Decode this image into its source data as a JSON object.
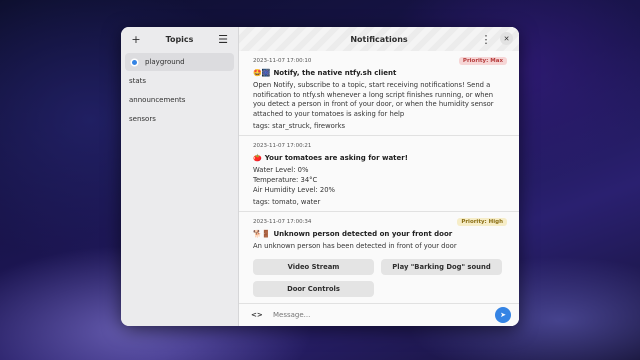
{
  "sidebar": {
    "title": "Topics",
    "add_icon": "+",
    "menu_icon": "☰",
    "topics": [
      {
        "label": "playground",
        "selected": true
      },
      {
        "label": "stats"
      },
      {
        "label": "announcements"
      },
      {
        "label": "sensors"
      }
    ]
  },
  "header": {
    "title": "Notifications",
    "menu_icon": "⋮",
    "close_icon": "✕"
  },
  "notifications": [
    {
      "timestamp": "2023-11-07 17:00:10",
      "priority": "Priority: Max",
      "emoji": "🤩🎆",
      "title": "Notify, the native ntfy.sh client",
      "body": "Open Notify, subscribe to a topic, start receiving notifications! Send a notification to ntfy.sh whenever a long script finishes running, or when you detect a person in front of your door, or when the humidity sensor attached to your tomatoes is asking for help",
      "tags": "tags: star_struck, fireworks"
    },
    {
      "timestamp": "2023-11-07 17:00:21",
      "emoji": "🍅",
      "title": "Your tomatoes are asking for water!",
      "body": "Water Level: 0%\nTemperature: 34°C\nAir Humidity Level: 20%",
      "tags": "tags: tomato, water"
    },
    {
      "timestamp": "2023-11-07 17:00:34",
      "priority": "Priority: High",
      "emoji": "🐕🚪",
      "title": "Unknown person detected on your front door",
      "body": "An unknown person has been detected in front of your door",
      "actions": [
        "Video Stream",
        "Play \"Barking Dog\" sound",
        "Door Controls"
      ]
    }
  ],
  "composer": {
    "code_icon": "<>",
    "placeholder": "Message...",
    "send_icon": "➤"
  },
  "colors": {
    "accent": "#3584e4",
    "priority_max_bg": "#f6d6d6",
    "priority_high_bg": "#f6edc8"
  }
}
